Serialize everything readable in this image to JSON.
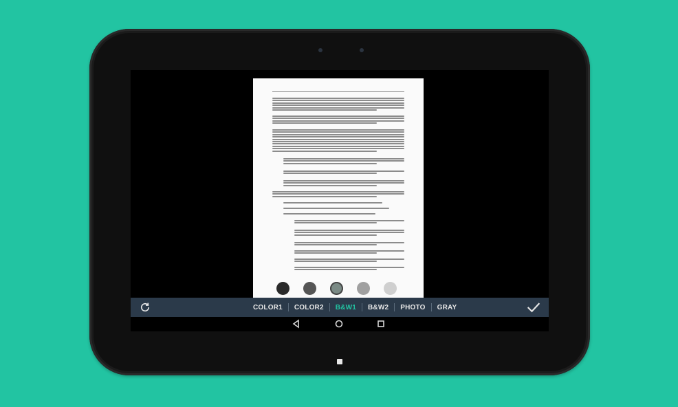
{
  "toolbar": {
    "tabs": [
      {
        "label": "COLOR1",
        "active": false
      },
      {
        "label": "COLOR2",
        "active": false
      },
      {
        "label": "B&W1",
        "active": true
      },
      {
        "label": "B&W2",
        "active": false
      },
      {
        "label": "PHOTO",
        "active": false
      },
      {
        "label": "GRAY",
        "active": false
      }
    ],
    "rotate_icon": "rotate-icon",
    "confirm_icon": "checkmark-icon",
    "accent_color": "#22c4a2",
    "bar_color": "#2b3a4a"
  },
  "swatches": [
    "#2a2a2a",
    "#555555",
    "#7a8a85",
    "#a0a0a0",
    "#cfcfcf"
  ],
  "navbar": {
    "back_icon": "back-triangle-icon",
    "home_icon": "home-circle-icon",
    "recents_icon": "recents-square-icon"
  },
  "background_color": "#22c4a2"
}
